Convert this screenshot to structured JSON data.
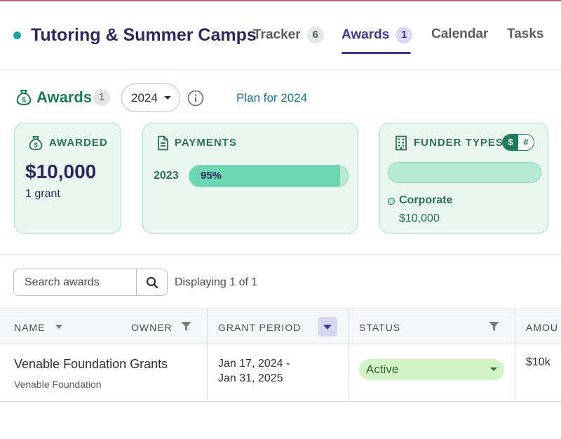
{
  "org": {
    "title": "Tutoring & Summer Camps"
  },
  "tabs": [
    {
      "label": "Tracker",
      "count": "6"
    },
    {
      "label": "Awards",
      "count": "1"
    },
    {
      "label": "Calendar"
    },
    {
      "label": "Tasks"
    }
  ],
  "awards": {
    "title": "Awards",
    "count": "1",
    "year": "2024",
    "plan_link": "Plan for 2024"
  },
  "cards": {
    "awarded": {
      "label": "AWARDED",
      "amount": "$10,000",
      "sub": "1 grant"
    },
    "payments": {
      "label": "PAYMENTS",
      "year": "2023",
      "percent_label": "95%",
      "progress": 0.95
    },
    "funder_types": {
      "label": "FUNDER TYPES",
      "toggle": {
        "dollar": "$",
        "count": "#"
      },
      "legend": [
        {
          "name": "Corporate",
          "value": "$10,000"
        }
      ]
    }
  },
  "search": {
    "placeholder": "Search awards",
    "displaying": "Displaying 1 of 1"
  },
  "table": {
    "columns": [
      "NAME",
      "OWNER",
      "GRANT PERIOD",
      "STATUS",
      "AMOU"
    ],
    "rows": [
      {
        "name": "Venable Foundation Grants",
        "funder": "Venable Foundation",
        "period_start": "Jan 17, 2024 -",
        "period_end": "Jan 31, 2025",
        "status": "Active",
        "amount": "$10k"
      }
    ]
  },
  "colors": {
    "brand": "#2d2a5a",
    "accent": "#3d3a8c",
    "green": "#1f7a5a",
    "card_bg": "#eaf7f1",
    "active_status": "#d2f3c6"
  }
}
